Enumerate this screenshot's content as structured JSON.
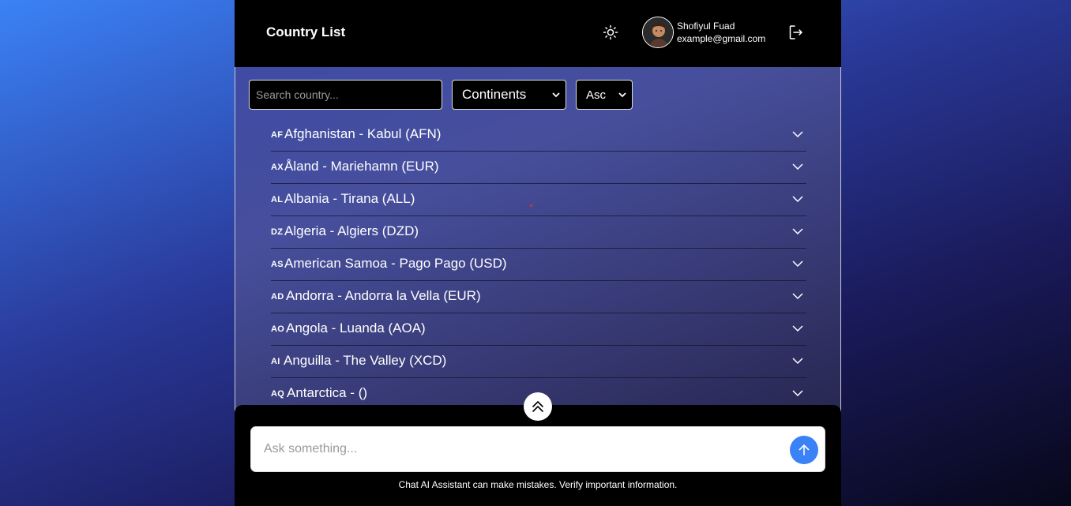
{
  "header": {
    "title": "Country List",
    "theme_icon": "sun-icon",
    "user": {
      "name": "Shofiyul Fuad",
      "email": "example@gmail.com"
    },
    "logout_icon": "logout-icon"
  },
  "filters": {
    "search_placeholder": "Search country...",
    "continent_selected": "Continents",
    "order_selected": "Asc"
  },
  "countries": [
    {
      "code": "AF",
      "label": "Afghanistan - Kabul (AFN)"
    },
    {
      "code": "AX",
      "label": "Åland - Mariehamn (EUR)"
    },
    {
      "code": "AL",
      "label": "Albania - Tirana (ALL)"
    },
    {
      "code": "DZ",
      "label": "Algeria - Algiers (DZD)"
    },
    {
      "code": "AS",
      "label": "American Samoa - Pago Pago (USD)"
    },
    {
      "code": "AD",
      "label": "Andorra - Andorra la Vella (EUR)"
    },
    {
      "code": "AO",
      "label": "Angola - Luanda (AOA)"
    },
    {
      "code": "AI",
      "label": "Anguilla - The Valley (XCD)"
    },
    {
      "code": "AQ",
      "label": "Antarctica - ()"
    }
  ],
  "chat": {
    "placeholder": "Ask something...",
    "disclaimer": "Chat AI Assistant can make mistakes. Verify important information.",
    "send_icon": "arrow-up-icon",
    "scroll_icon": "double-chevron-up-icon"
  },
  "colors": {
    "accent": "#3b82f6",
    "header_bg": "#000000"
  }
}
